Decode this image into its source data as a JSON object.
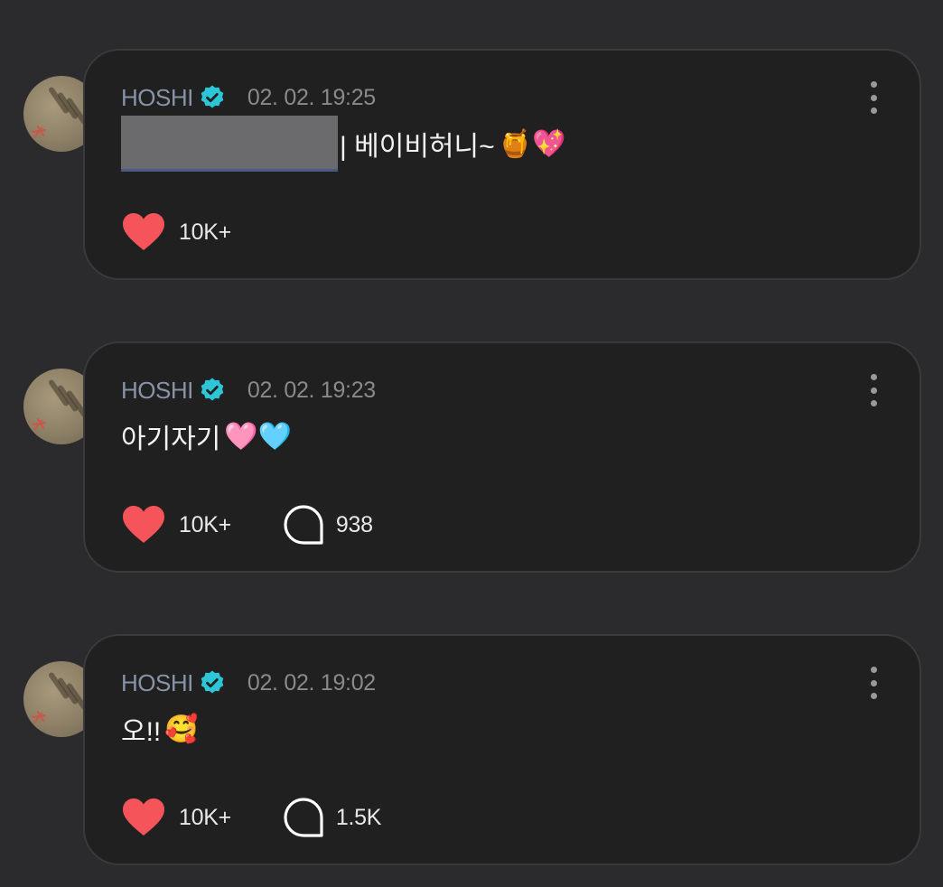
{
  "colors": {
    "background": "#2b2b2d",
    "card": "#202021",
    "card_border": "#3a3a3c",
    "name": "#8794a8",
    "verified": "#2cc6d6",
    "heart": "#f5545a",
    "text": "#f2f2f2"
  },
  "posts": [
    {
      "author": "HOSHI",
      "date": "02. 02. 19:25",
      "text": "| 베이비허니~",
      "emoji": "🍯💖",
      "likes": "10K+",
      "comments": null
    },
    {
      "author": "HOSHI",
      "date": "02. 02. 19:23",
      "text": "아기자기",
      "emoji": "🩷🩵",
      "likes": "10K+",
      "comments": "938"
    },
    {
      "author": "HOSHI",
      "date": "02. 02. 19:02",
      "text": "오!!",
      "emoji": "🥰",
      "likes": "10K+",
      "comments": "1.5K"
    }
  ],
  "icons": {
    "verified": "verified-badge-icon",
    "more": "more-vertical-icon",
    "like": "heart-icon",
    "comment": "comment-bubble-icon"
  }
}
